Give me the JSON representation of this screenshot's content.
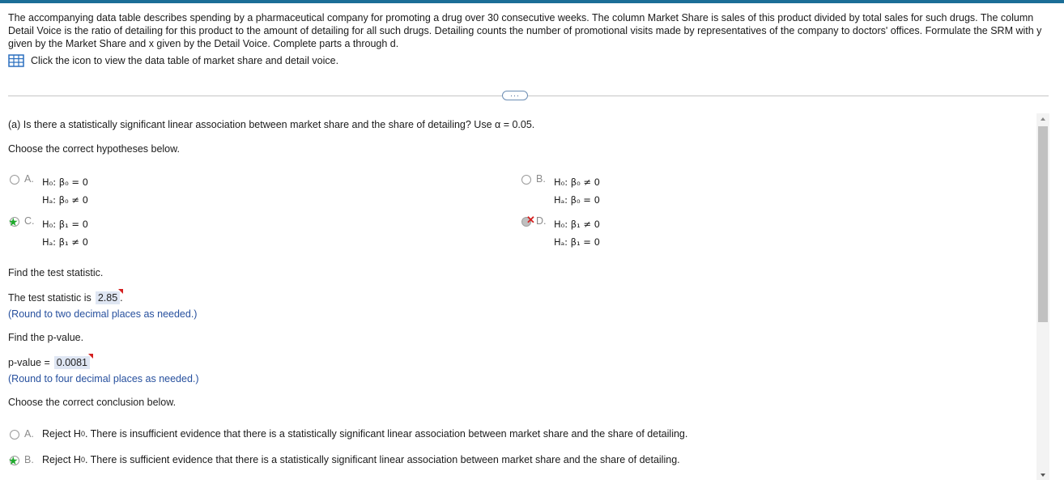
{
  "intro": {
    "text": "The accompanying data table describes spending by a pharmaceutical company for promoting a drug over 30 consecutive weeks. The column Market Share is sales of this product divided by total sales for such drugs. The column Detail Voice is the ratio of detailing for this product to the amount of detailing for all such drugs. Detailing counts the number of promotional visits made by representatives of the company to doctors' offices. Formulate the SRM with y given by the Market Share and x given by the Detail Voice. Complete parts a through d.",
    "table_link": "Click the icon to view the data table of market share and detail voice.",
    "icon": "table-grid-icon"
  },
  "more_button": "···",
  "part_a": {
    "question": "(a) Is there a statistically significant linear association between market share and the share of detailing? Use α = 0.05.",
    "choose_hyp": "Choose the correct hypotheses below.",
    "options": [
      {
        "letter": "A.",
        "h0": "H₀: β₀ = 0",
        "ha": "Hₐ: β₀ ≠ 0"
      },
      {
        "letter": "B.",
        "h0": "H₀: β₀ ≠ 0",
        "ha": "Hₐ: β₀ = 0"
      },
      {
        "letter": "C.",
        "h0": "H₀: β₁ = 0",
        "ha": "Hₐ: β₁ ≠ 0"
      },
      {
        "letter": "D.",
        "h0": "H₀: β₁ ≠ 0",
        "ha": "Hₐ: β₁ = 0"
      }
    ],
    "find_ts": "Find the test statistic.",
    "ts_prefix": "The test statistic is",
    "ts_value": "2.85",
    "ts_suffix": ".",
    "ts_round": "(Round to two decimal places as needed.)",
    "find_pv": "Find the p-value.",
    "pv_prefix": "p-value =",
    "pv_value": "0.0081",
    "pv_round": "(Round to four decimal places as needed.)",
    "choose_concl": "Choose the correct conclusion below.",
    "conclusions": [
      {
        "letter": "A.",
        "reject": "Reject H",
        "sub": "0",
        "text": ". There is insufficient evidence that there is a statistically significant linear association between market share and the share of detailing."
      },
      {
        "letter": "B.",
        "reject": "Reject H",
        "sub": "0",
        "text": ". There is sufficient evidence that there is a statistically significant linear association between market share and the share of detailing."
      }
    ]
  },
  "colors": {
    "accent": "#1b6e97",
    "correct": "#1faa2c",
    "incorrect": "#d42020",
    "note": "#27509e",
    "answer_bg": "#dfe6f3"
  }
}
